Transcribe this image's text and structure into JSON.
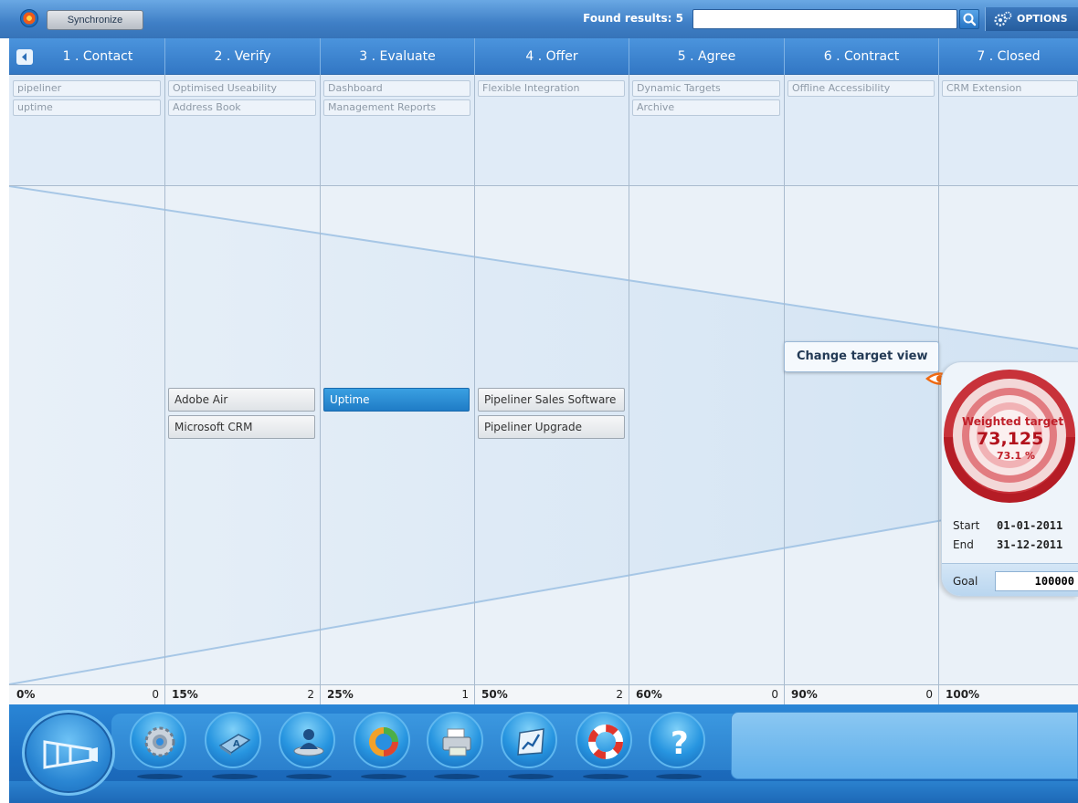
{
  "topbar": {
    "sync_label": "Synchronize",
    "found_results": "Found results: 5",
    "search_value": "",
    "options_label": "OPTIONS"
  },
  "stages": [
    {
      "label": "1 . Contact"
    },
    {
      "label": "2 . Verify"
    },
    {
      "label": "3 . Evaluate"
    },
    {
      "label": "4 . Offer"
    },
    {
      "label": "5 . Agree"
    },
    {
      "label": "6 . Contract"
    },
    {
      "label": "7 . Closed"
    }
  ],
  "tags": [
    [
      "pipeliner",
      "uptime"
    ],
    [
      "Optimised Useability",
      "Address Book"
    ],
    [
      "Dashboard",
      "Management Reports"
    ],
    [
      "Flexible Integration"
    ],
    [
      "Dynamic Targets",
      "Archive"
    ],
    [
      "Offline Accessibility"
    ],
    [
      "CRM Extension"
    ]
  ],
  "deals": [
    [],
    [
      {
        "label": "Adobe Air",
        "active": false
      },
      {
        "label": "Microsoft CRM",
        "active": false
      }
    ],
    [
      {
        "label": "Uptime",
        "active": true
      }
    ],
    [
      {
        "label": "Pipeliner Sales Software",
        "active": false
      },
      {
        "label": "Pipeliner Upgrade",
        "active": false
      }
    ],
    [],
    [],
    []
  ],
  "stats": [
    {
      "pct": "0%",
      "count": "0"
    },
    {
      "pct": "15%",
      "count": "2"
    },
    {
      "pct": "25%",
      "count": "1"
    },
    {
      "pct": "50%",
      "count": "2"
    },
    {
      "pct": "60%",
      "count": "0"
    },
    {
      "pct": "90%",
      "count": "0"
    },
    {
      "pct": "100%",
      "count": ""
    }
  ],
  "target": {
    "tooltip": "Change target view",
    "title": "Weighted target",
    "value": "73,125",
    "percent": "73.1 %",
    "start_label": "Start",
    "start": "01-01-2011",
    "end_label": "End",
    "end": "31-12-2011",
    "goal_label": "Goal",
    "goal": "100000"
  },
  "dock": {
    "icons": [
      "gear-icon",
      "address-book-icon",
      "contact-person-icon",
      "pie-chart-icon",
      "printer-icon",
      "report-chart-icon",
      "lifebuoy-icon",
      "help-icon"
    ]
  },
  "colors": {
    "accent": "#3277c4",
    "active_deal": "#1f7cc6",
    "target_red": "#c0202a"
  }
}
